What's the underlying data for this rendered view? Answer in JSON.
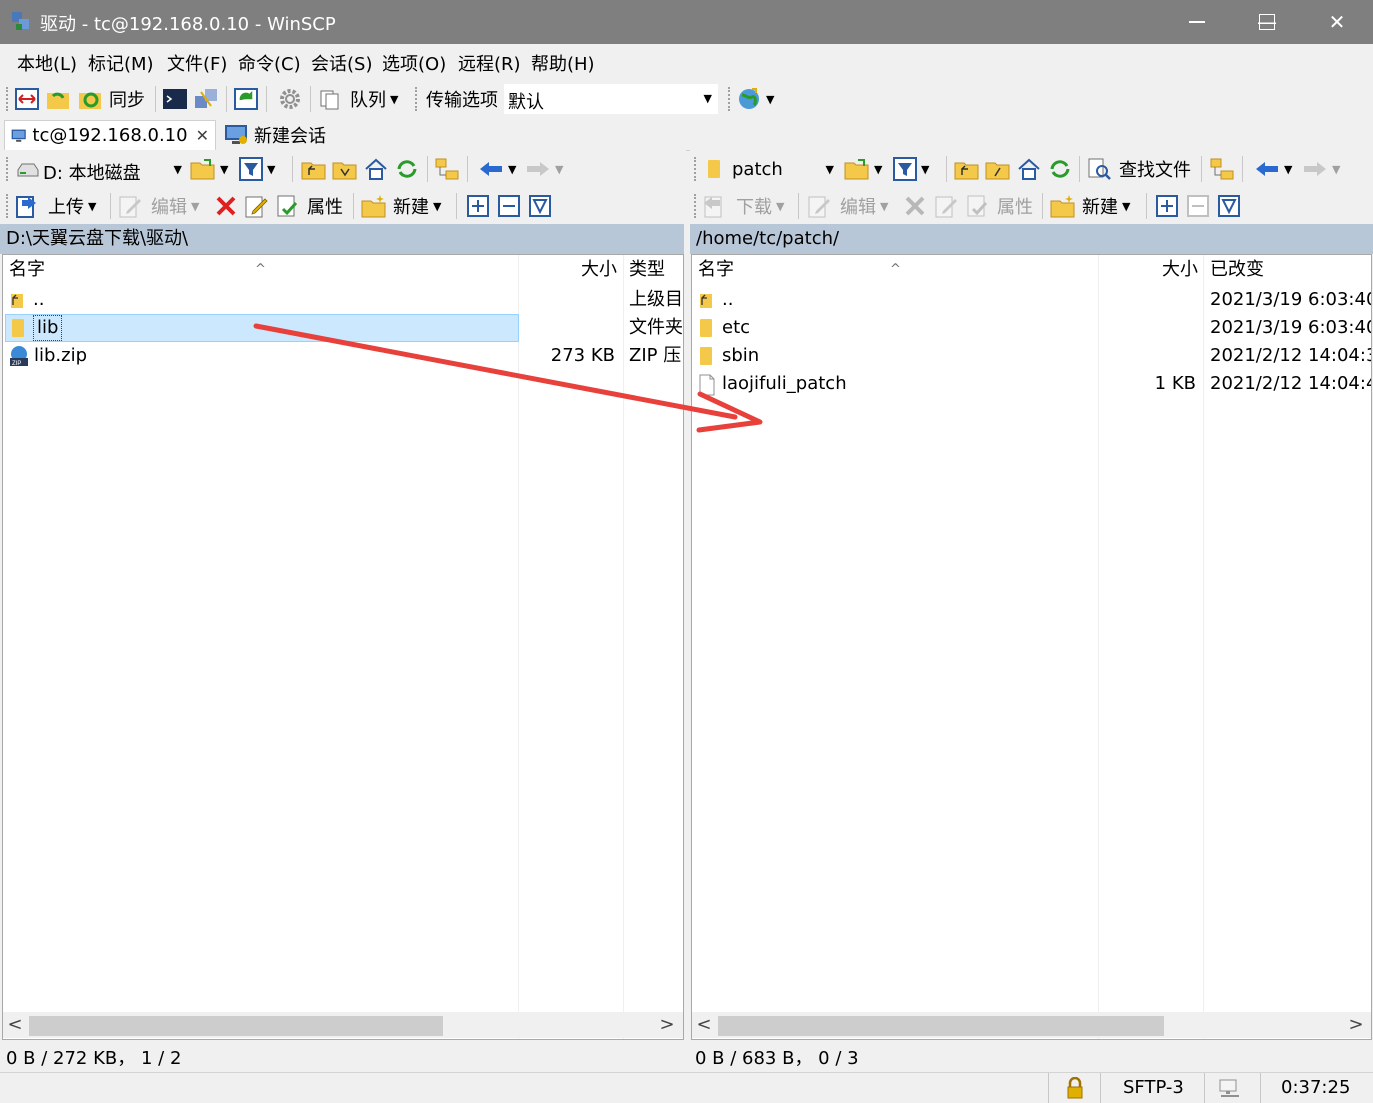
{
  "window": {
    "title": "驱动 - tc@192.168.0.10 - WinSCP",
    "minimize": "—",
    "maximize": "☐",
    "close": "✕"
  },
  "menu": [
    "本地(L)",
    "标记(M)",
    "文件(F)",
    "命令(C)",
    "会话(S)",
    "选项(O)",
    "远程(R)",
    "帮助(H)"
  ],
  "toolbar": {
    "sync_label": "同步",
    "queue_label": "队列",
    "transfer_label": "传输选项",
    "transfer_value": "默认"
  },
  "tabs": {
    "session": "tc@192.168.0.10",
    "new_session": "新建会话"
  },
  "left": {
    "drive": "D: 本地磁盘",
    "upload": "上传",
    "edit": "编辑",
    "properties": "属性",
    "new": "新建",
    "path": "D:\\天翼云盘下载\\驱动\\",
    "columns": {
      "name": "名字",
      "size": "大小",
      "type": "类型"
    },
    "rows": [
      {
        "name": "..",
        "size": "",
        "type": "上级目"
      },
      {
        "name": "lib",
        "size": "",
        "type": "文件夹"
      },
      {
        "name": "lib.zip",
        "size": "273 KB",
        "type": "ZIP 压"
      }
    ],
    "status": "0 B / 272 KB， 1 / 2"
  },
  "right": {
    "dir": "patch",
    "find": "查找文件",
    "download": "下载",
    "edit": "编辑",
    "properties": "属性",
    "new": "新建",
    "path": "/home/tc/patch/",
    "columns": {
      "name": "名字",
      "size": "大小",
      "changed": "已改变"
    },
    "rows": [
      {
        "name": "..",
        "size": "",
        "changed": "2021/3/19 6:03:40"
      },
      {
        "name": "etc",
        "size": "",
        "changed": "2021/3/19 6:03:40"
      },
      {
        "name": "sbin",
        "size": "",
        "changed": "2021/2/12 14:04:3"
      },
      {
        "name": "laojifuli_patch",
        "size": "1 KB",
        "changed": "2021/2/12 14:04:4"
      }
    ],
    "status": "0 B / 683 B， 0 / 3"
  },
  "statusbar": {
    "protocol": "SFTP-3",
    "time": "0:37:25"
  },
  "colors": {
    "annotation_arrow": "#e8403a",
    "pathbar": "#b7c7d8",
    "selection": "#cce8ff"
  }
}
